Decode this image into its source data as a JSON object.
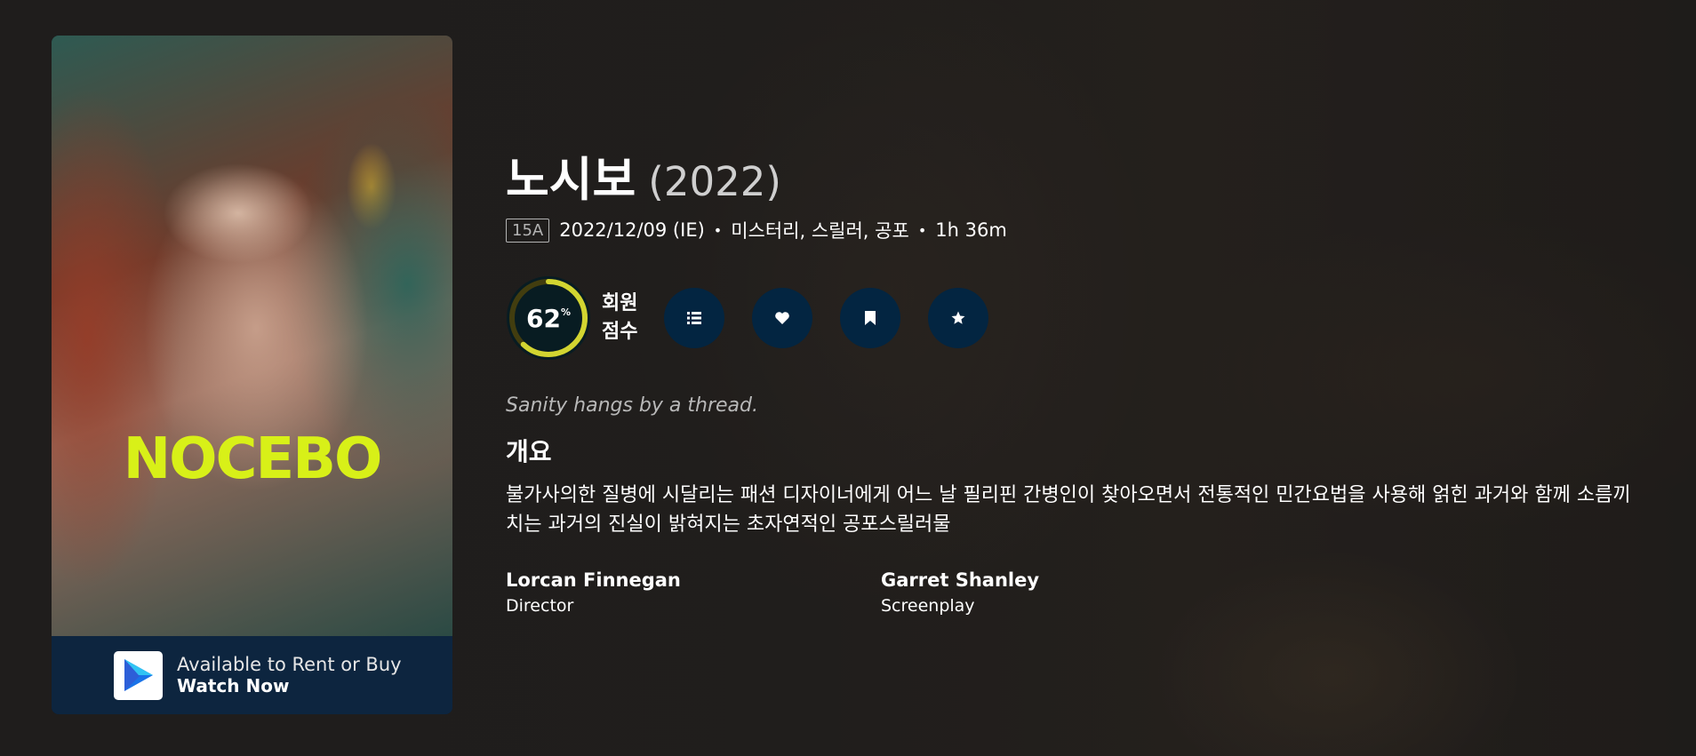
{
  "poster": {
    "title_text": "NOCEBO",
    "watch": {
      "line1": "Available to Rent or Buy",
      "line2": "Watch Now"
    }
  },
  "movie": {
    "title": "노시보",
    "year": "(2022)",
    "certification": "15A",
    "release": "2022/12/09 (IE)",
    "genres": "미스터리, 스릴러, 공포",
    "runtime": "1h 36m",
    "bullet": "•"
  },
  "score": {
    "value": "62",
    "unit": "%",
    "fraction": 0.62,
    "label_line1": "회원",
    "label_line2": "점수",
    "track_color": "#423d0f",
    "bar_color": "#d2d531"
  },
  "actions": [
    {
      "name": "list-icon"
    },
    {
      "name": "heart-icon"
    },
    {
      "name": "bookmark-icon"
    },
    {
      "name": "star-icon"
    }
  ],
  "tagline": "Sanity hangs by a thread.",
  "overview_heading": "개요",
  "overview": "불가사의한 질병에 시달리는 패션 디자이너에게 어느 날 필리핀 간병인이 찾아오면서 전통적인 민간요법을 사용해 얽힌 과거와 함께 소름끼치는 과거의 진실이 밝혀지는 초자연적인 공포스릴러물",
  "crew": [
    {
      "name": "Lorcan Finnegan",
      "role": "Director"
    },
    {
      "name": "Garret Shanley",
      "role": "Screenplay"
    }
  ],
  "colors": {
    "poster_title": "#d8f018",
    "button_bg": "#032541",
    "watch_bar_bg": "#0d253f"
  }
}
